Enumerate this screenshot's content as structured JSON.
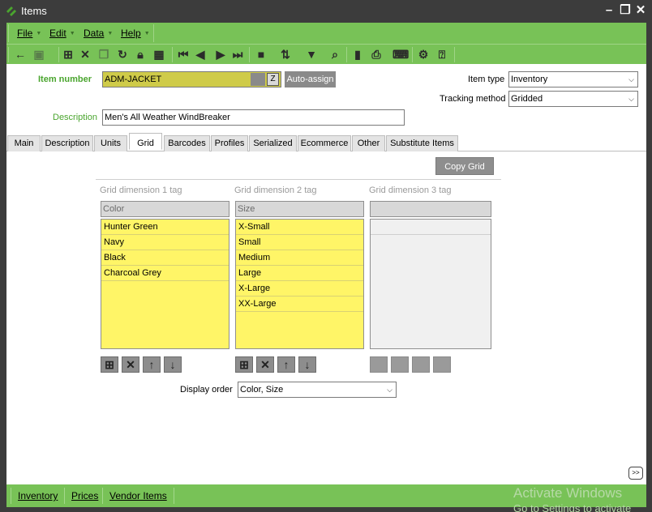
{
  "window": {
    "title": "Items"
  },
  "menu": [
    "File",
    "Edit",
    "Data",
    "Help"
  ],
  "toolbar_icons": [
    "back-arrow-icon",
    "save-icon",
    "add-icon",
    "delete-icon",
    "copy-icon",
    "refresh-icon",
    "lock-icon",
    "grid-icon",
    "first-record-icon",
    "previous-record-icon",
    "next-record-icon",
    "last-record-icon",
    "bookmark-icon",
    "sort-icon",
    "filter-icon",
    "search-icon",
    "document-icon",
    "print-icon",
    "keyboard-icon",
    "help-context-icon",
    "help-icon"
  ],
  "header": {
    "item_number_label": "Item number",
    "item_number_value": "ADM-JACKET",
    "zoom_glyph": "Z",
    "auto_assign_label": "Auto-assign",
    "description_label": "Description",
    "description_value": "Men's All Weather WindBreaker",
    "item_type_label": "Item type",
    "item_type_value": "Inventory",
    "tracking_method_label": "Tracking method",
    "tracking_method_value": "Gridded"
  },
  "tabs": [
    "Main",
    "Description",
    "Units",
    "Grid",
    "Barcodes",
    "Profiles",
    "Serialized",
    "Ecommerce",
    "Other",
    "Substitute Items"
  ],
  "active_tab": "Grid",
  "grid": {
    "copy_grid_label": "Copy Grid",
    "dimensions": [
      {
        "label": "Grid dimension 1 tag",
        "tag": "Color",
        "values": [
          "Hunter Green",
          "Navy",
          "Black",
          "Charcoal Grey"
        ]
      },
      {
        "label": "Grid dimension 2 tag",
        "tag": "Size",
        "values": [
          "X-Small",
          "Small",
          "Medium",
          "Large",
          "X-Large",
          "XX-Large"
        ]
      },
      {
        "label": "Grid dimension 3 tag",
        "tag": "",
        "values": []
      }
    ],
    "display_order_label": "Display order",
    "display_order_value": "Color, Size"
  },
  "footer_links": [
    "Inventory",
    "Prices",
    "Vendor Items"
  ],
  "expand_button": ">>",
  "watermark": {
    "line1": "Activate Windows",
    "line2": "Go to Settings to activate"
  },
  "colors": {
    "accent_green": "#78c257",
    "label_green": "#4aa52e",
    "list_yellow": "#fff567",
    "key_field_yellow": "#cfcb49"
  }
}
